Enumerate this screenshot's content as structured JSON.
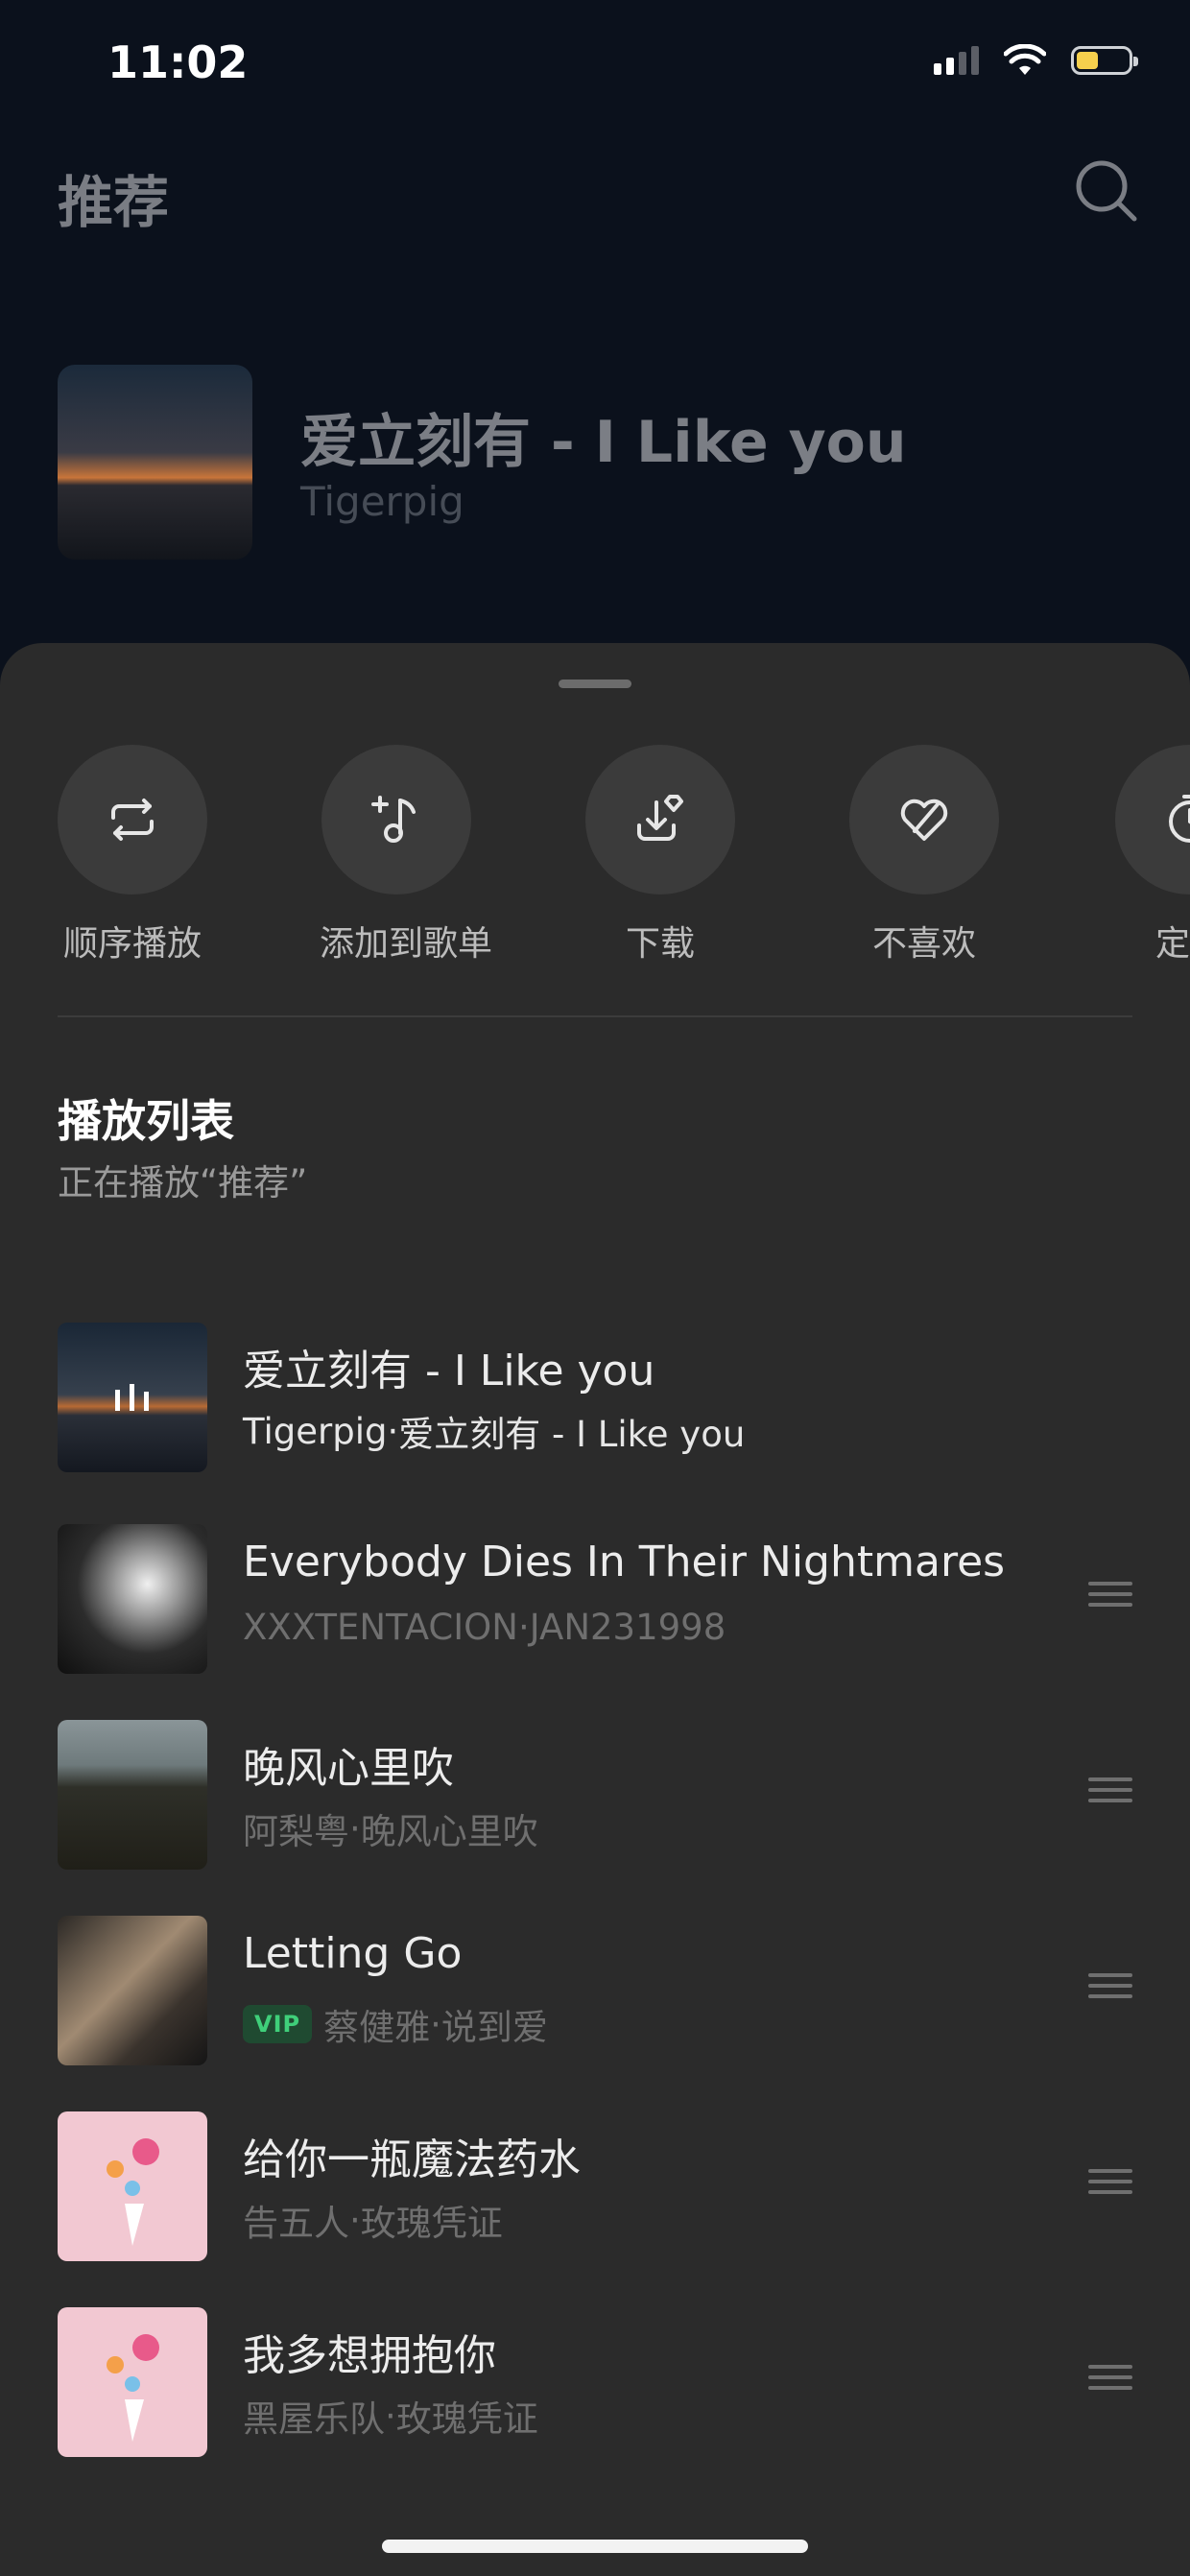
{
  "status_bar": {
    "time": "11:02"
  },
  "header": {
    "title": "推荐"
  },
  "now_playing": {
    "title": "爱立刻有 - I Like you",
    "artist": "Tigerpig"
  },
  "actions": [
    {
      "label": "顺序播放",
      "icon": "repeat-icon"
    },
    {
      "label": "添加到歌单",
      "icon": "add-to-playlist-icon"
    },
    {
      "label": "下载",
      "icon": "download-icon"
    },
    {
      "label": "不喜欢",
      "icon": "dislike-heart-icon"
    },
    {
      "label": "定时",
      "icon": "timer-icon"
    }
  ],
  "playlist": {
    "title": "播放列表",
    "subtitle": "正在播放“推荐”",
    "items": [
      {
        "title": "爱立刻有 - I Like you",
        "artist": "Tigerpig",
        "album": "爱立刻有 - I Like you",
        "separator": " · ",
        "playing": true,
        "vip": false
      },
      {
        "title": "Everybody Dies In Their Nightmares",
        "artist": "XXXTENTACION",
        "album": "JAN231998",
        "separator": " · ",
        "playing": false,
        "vip": false
      },
      {
        "title": "晚风心里吹",
        "artist": "阿梨粤",
        "album": "晚风心里吹",
        "separator": " · ",
        "playing": false,
        "vip": false
      },
      {
        "title": "Letting Go",
        "artist": "蔡健雅",
        "album": "说到爱",
        "separator": " · ",
        "playing": false,
        "vip": true,
        "vip_label": "VIP"
      },
      {
        "title": "给你一瓶魔法药水",
        "artist": "告五人",
        "album": "玫瑰凭证",
        "separator": " · ",
        "playing": false,
        "vip": false
      },
      {
        "title": "我多想拥抱你",
        "artist": "黑屋乐队",
        "album": "玫瑰凭证",
        "separator": " · ",
        "playing": false,
        "vip": false
      }
    ]
  },
  "colors": {
    "sheet_bg": "#2b2b2b",
    "page_bg": "#0b111c",
    "vip_green": "#3fcf7a",
    "battery_yellow": "#f6d04d"
  }
}
